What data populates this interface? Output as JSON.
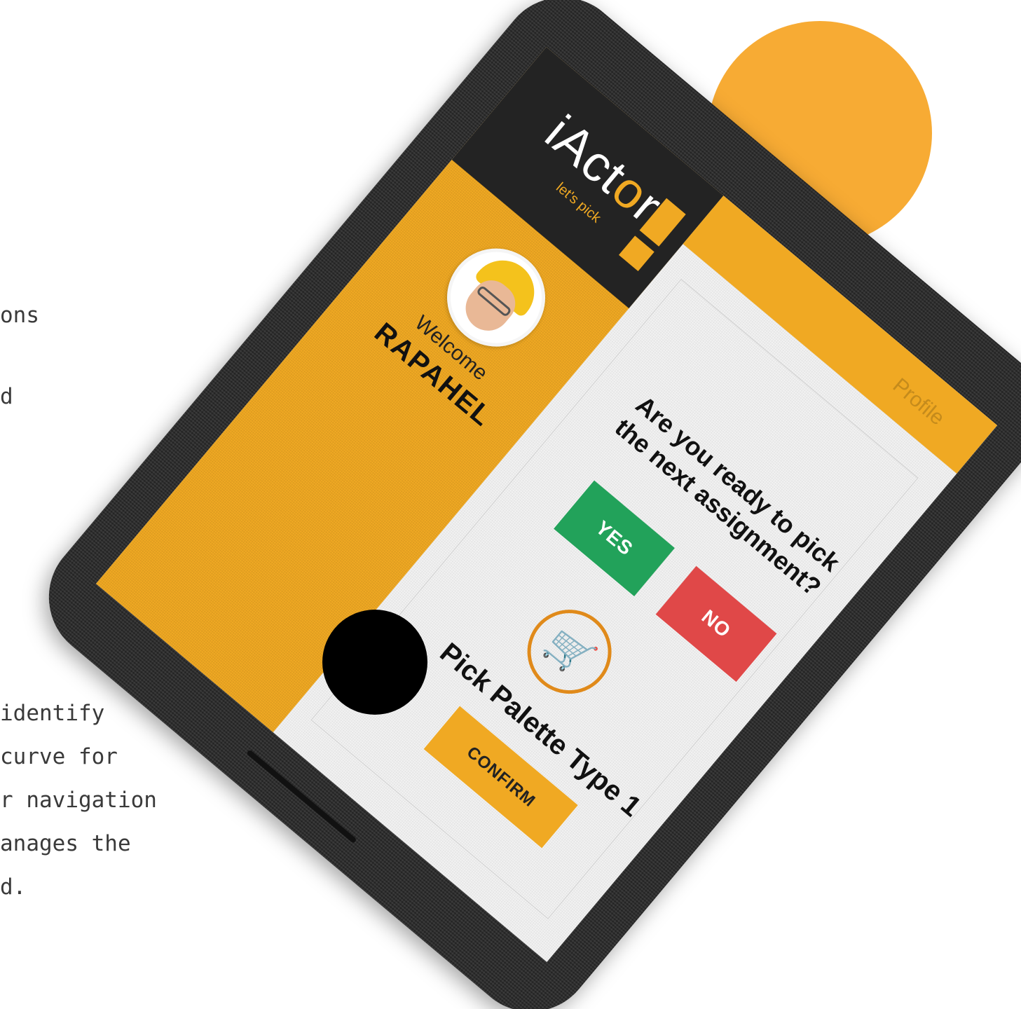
{
  "side_text": {
    "line1": "ons",
    "line2": "d",
    "line3": " identify",
    "line4": " curve for",
    "line5": "r navigation",
    "line6": "anages the",
    "line7": "d."
  },
  "app": {
    "logo_text_a": "iAct",
    "logo_text_o": "o",
    "logo_text_r": "r",
    "tagline": "let's pick"
  },
  "drawer": {
    "welcome": "Welcome",
    "user_name": "RAPAHEL"
  },
  "nav": {
    "tab_profile": "Profile"
  },
  "main": {
    "question": "Are you ready to pick the next assignment?",
    "yes_label": "YES",
    "no_label": "NO",
    "pick_label": "Pick Palette Type 1",
    "confirm_label": "CONFIRM",
    "cart_icon": "cart-icon"
  },
  "colors": {
    "accent": "#f0a923",
    "circle": "#f7ab34",
    "yes": "#22a25a",
    "no": "#e04848"
  }
}
